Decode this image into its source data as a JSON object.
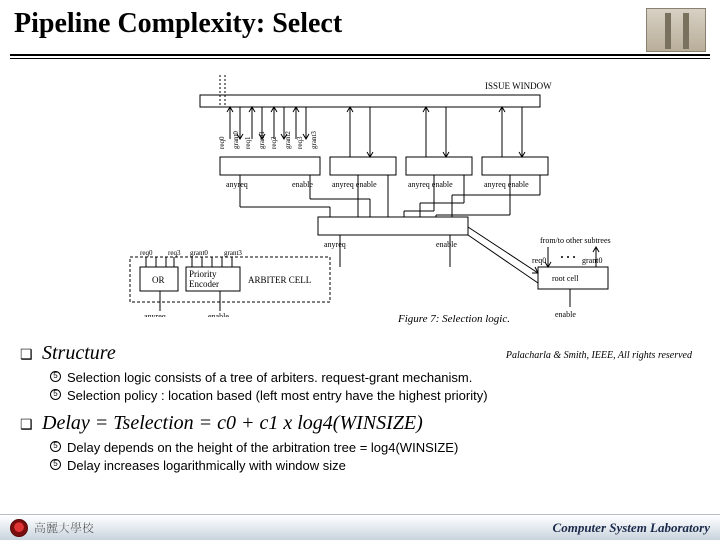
{
  "title": "Pipeline Complexity: Select",
  "figure": {
    "issue_window_label": "ISSUE WINDOW",
    "top_ports": [
      "req0",
      "grant0",
      "req1",
      "grant1",
      "req2",
      "grant2",
      "req3",
      "grant3"
    ],
    "anyreq_label": "anyreq",
    "enable_label": "enable",
    "anyreq_enable_label": "anyreq enable",
    "or_label": "OR",
    "priority_encoder_label": "Priority\nEncoder",
    "arbiter_cell_label": "ARBITER CELL",
    "subtree_label": "from/to other subtrees",
    "root_req_label": "req0",
    "root_grant_label": "grant0",
    "root_cell_label": "root cell",
    "figure_caption": "Figure 7: Selection logic."
  },
  "citation": "Palacharla & Smith, IEEE, All rights reserved",
  "sections": [
    {
      "heading_prefix": "❑",
      "heading": "Structure",
      "bullets": [
        "Selection logic consists of a tree of arbiters. request-grant mechanism.",
        "Selection policy : location based (left most entry have the highest priority)"
      ]
    },
    {
      "heading_prefix": "❑",
      "heading_html": "Delay = Tselection = c0 + c1  x  log4(WINSIZE)",
      "bullets": [
        "Delay depends on the height of the arbitration tree = log4(WINSIZE)",
        "Delay increases logarithmically with window size"
      ]
    }
  ],
  "footer": {
    "left": "高麗大學校",
    "right": "Computer System Laboratory"
  }
}
